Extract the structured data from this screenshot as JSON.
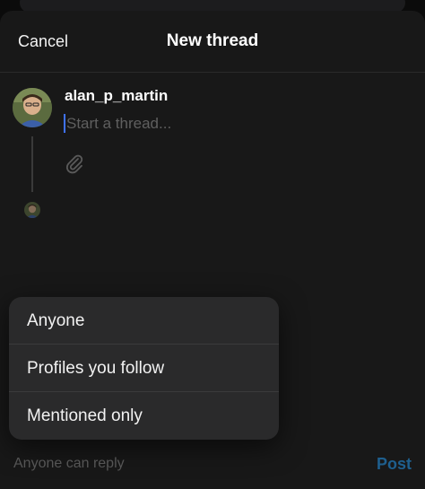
{
  "header": {
    "cancel_label": "Cancel",
    "title": "New thread"
  },
  "composer": {
    "username": "alan_p_martin",
    "placeholder": "Start a thread...",
    "value": "",
    "attach_icon": "paperclip-icon",
    "avatar_icon": "user-avatar"
  },
  "reply_menu": {
    "options": [
      "Anyone",
      "Profiles you follow",
      "Mentioned only"
    ]
  },
  "footer": {
    "reply_setting": "Anyone can reply",
    "post_label": "Post"
  },
  "colors": {
    "accent_caret": "#3f72ff",
    "post_disabled": "#1e5f8e",
    "sheet_bg": "#181818",
    "menu_bg": "#2a2a2b"
  }
}
